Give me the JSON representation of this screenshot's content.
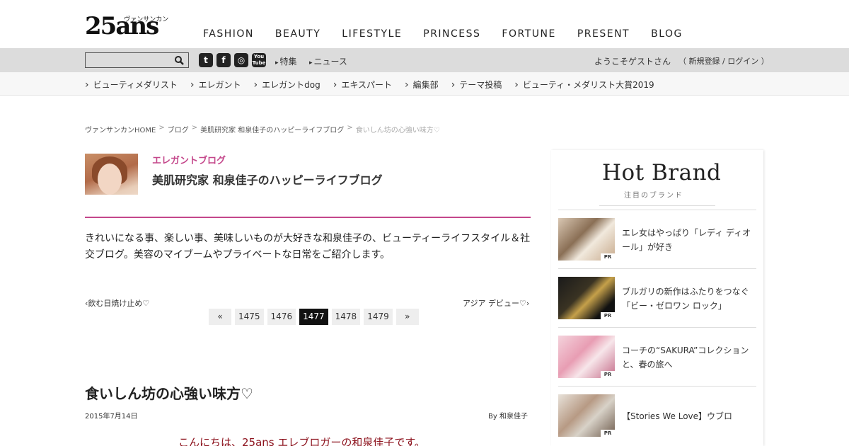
{
  "logo": {
    "main": "25ans",
    "kana": "ヴァンサンカン"
  },
  "main_nav": [
    "FASHION",
    "BEAUTY",
    "LIFESTYLE",
    "PRINCESS",
    "FORTUNE",
    "PRESENT",
    "BLOG"
  ],
  "util_bar": {
    "search_placeholder": "",
    "social": [
      "twitter-icon",
      "facebook-icon",
      "instagram-icon",
      "youtube-icon"
    ],
    "links": [
      "特集",
      "ニュース"
    ],
    "welcome": "ようこそゲストさん",
    "login": "（ 新規登録 / ログイン ）"
  },
  "sub_nav": [
    "ビューティメダリスト",
    "エレガント",
    "エレガントdog",
    "エキスパート",
    "編集部",
    "テーマ投稿",
    "ビューティ・メダリスト大賞2019"
  ],
  "breadcrumb": [
    "ヴァンサンカンHOME",
    "ブログ",
    "美肌研究家 和泉佳子のハッピーライフブログ",
    "食いしん坊の心強い味方♡"
  ],
  "blog": {
    "category": "エレガントブログ",
    "name": "美肌研究家 和泉佳子のハッピーライフブログ",
    "description": "きれいになる事、楽しい事、美味しいものが大好きな和泉佳子の、ビューティーライフスタイル＆社交ブログ。美容のマイブームやプライベートな日常をご紹介します。"
  },
  "pager": {
    "prev": "飲む日焼け止め♡",
    "next": "アジア デビュー♡",
    "items": [
      "«",
      "1475",
      "1476",
      "1477",
      "1478",
      "1479",
      "»"
    ],
    "active": "1477"
  },
  "article": {
    "title": "食いしん坊の心強い味方♡",
    "date": "2015年7月14日",
    "author": "By 和泉佳子",
    "intro": "こんにちは、25ans エレブロガーの和泉佳子です。"
  },
  "sidebar": {
    "title": "Hot Brand",
    "subtitle": "注目のブランド",
    "items": [
      {
        "text": "エレ女はやっぱり「レディ ディオール」が好き",
        "badge": "PR"
      },
      {
        "text": "ブルガリの新作はふたりをつなぐ「ビー・ゼロワン ロック」",
        "badge": "PR"
      },
      {
        "text": "コーチの“SAKURA”コレクションと、春の旅へ",
        "badge": "PR"
      },
      {
        "text": "【Stories We Love】ウブロ",
        "badge": "PR"
      }
    ]
  }
}
